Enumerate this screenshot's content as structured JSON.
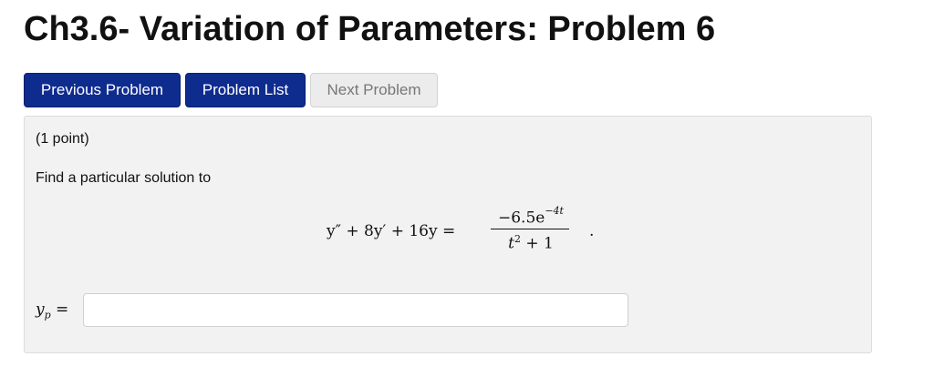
{
  "page": {
    "title": "Ch3.6- Variation of Parameters: Problem 6"
  },
  "nav": {
    "previous_label": "Previous Problem",
    "list_label": "Problem List",
    "next_label": "Next Problem"
  },
  "problem": {
    "points": "(1 point)",
    "prompt": "Find a particular solution to",
    "equation": {
      "lhs": "y″ + 8y′ + 16y =",
      "numerator": "−6.5e",
      "numerator_exponent": "−4t",
      "denominator": "t",
      "denominator_exponent": "2",
      "denominator_rest": " + 1",
      "end": "."
    },
    "answer": {
      "label": "y",
      "label_subscript": "p",
      "label_equals": " =",
      "value": "",
      "placeholder": ""
    }
  },
  "colors": {
    "primary_button": "#0e2b8e",
    "disabled_button": "#ececec",
    "problem_background": "#f2f2f2"
  }
}
